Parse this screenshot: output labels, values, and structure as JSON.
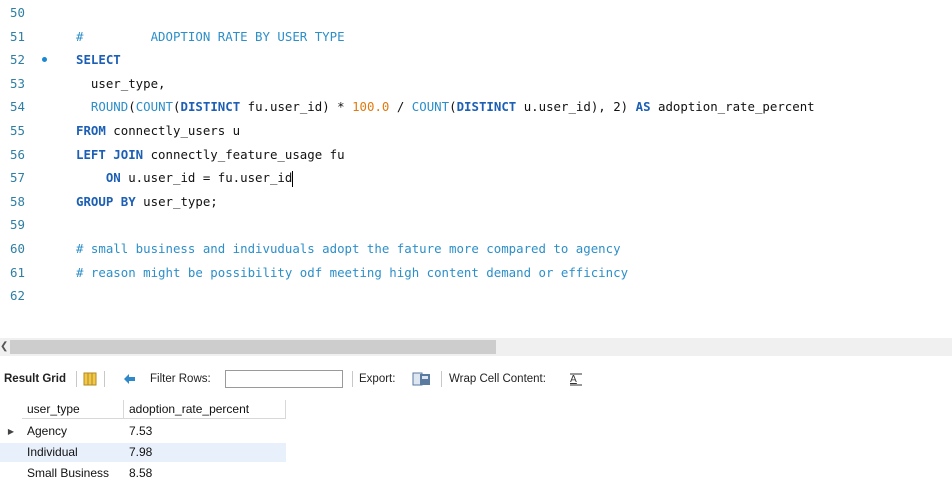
{
  "editor": {
    "lines": [
      {
        "num": "50",
        "segments": []
      },
      {
        "num": "51",
        "segments": [
          {
            "cls": "cm",
            "text": "#         ADOPTION RATE BY USER TYPE"
          }
        ]
      },
      {
        "num": "52",
        "marker": true,
        "segments": [
          {
            "cls": "kw",
            "text": "SELECT"
          }
        ]
      },
      {
        "num": "53",
        "segments": [
          {
            "cls": "tx",
            "text": "  user_type,"
          }
        ]
      },
      {
        "num": "54",
        "segments": [
          {
            "cls": "tx",
            "text": "  "
          },
          {
            "cls": "fn",
            "text": "ROUND"
          },
          {
            "cls": "tx",
            "text": "("
          },
          {
            "cls": "fn",
            "text": "COUNT"
          },
          {
            "cls": "tx",
            "text": "("
          },
          {
            "cls": "kw",
            "text": "DISTINCT"
          },
          {
            "cls": "tx",
            "text": " fu.user_id) * "
          },
          {
            "cls": "num",
            "text": "100.0"
          },
          {
            "cls": "tx",
            "text": " / "
          },
          {
            "cls": "fn",
            "text": "COUNT"
          },
          {
            "cls": "tx",
            "text": "("
          },
          {
            "cls": "kw",
            "text": "DISTINCT"
          },
          {
            "cls": "tx",
            "text": " u.user_id), 2) "
          },
          {
            "cls": "kw",
            "text": "AS"
          },
          {
            "cls": "tx",
            "text": " adoption_rate_percent"
          }
        ]
      },
      {
        "num": "55",
        "segments": [
          {
            "cls": "kw",
            "text": "FROM"
          },
          {
            "cls": "tx",
            "text": " connectly_users u"
          }
        ]
      },
      {
        "num": "56",
        "segments": [
          {
            "cls": "kw",
            "text": "LEFT JOIN"
          },
          {
            "cls": "tx",
            "text": " connectly_feature_usage fu"
          }
        ]
      },
      {
        "num": "57",
        "caret": true,
        "segments": [
          {
            "cls": "tx",
            "text": "    "
          },
          {
            "cls": "kw",
            "text": "ON"
          },
          {
            "cls": "tx",
            "text": " u.user_id = fu.user_id"
          }
        ]
      },
      {
        "num": "58",
        "segments": [
          {
            "cls": "kw",
            "text": "GROUP BY"
          },
          {
            "cls": "tx",
            "text": " user_type;"
          }
        ]
      },
      {
        "num": "59",
        "segments": []
      },
      {
        "num": "60",
        "segments": [
          {
            "cls": "cm",
            "text": "# small business and indivuduals adopt the fature more compared to agency"
          }
        ]
      },
      {
        "num": "61",
        "segments": [
          {
            "cls": "cm",
            "text": "# reason might be possibility odf meeting high content demand or efficincy"
          }
        ]
      },
      {
        "num": "62",
        "segments": []
      }
    ]
  },
  "toolbar": {
    "result_grid_label": "Result Grid",
    "filter_rows_label": "Filter Rows:",
    "filter_value": "",
    "export_label": "Export:",
    "wrap_label": "Wrap Cell Content:"
  },
  "grid": {
    "columns": [
      "user_type",
      "adoption_rate_percent"
    ],
    "rows": [
      {
        "user_type": "Agency",
        "adoption_rate_percent": "7.53"
      },
      {
        "user_type": "Individual",
        "adoption_rate_percent": "7.98"
      },
      {
        "user_type": "Small Business",
        "adoption_rate_percent": "8.58"
      }
    ]
  },
  "colors": {
    "keyword": "#1c5fb5",
    "function": "#2d8fc9",
    "number": "#e07a10",
    "comment": "#2d8fc9",
    "line_number": "#2e7fa3",
    "selected_row": "#e8f0fb"
  }
}
